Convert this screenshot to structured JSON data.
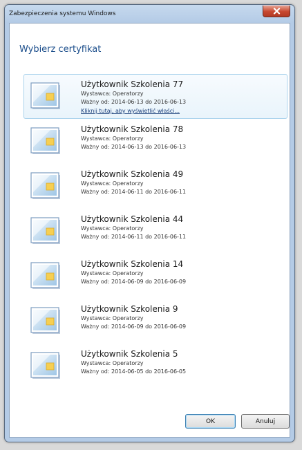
{
  "window": {
    "title": "Zabezpieczenia systemu Windows",
    "heading": "Wybierz certyfikat"
  },
  "certificates": [
    {
      "name": "Użytkownik Szkolenia 77",
      "issuer": "Wystawca: Operatorzy",
      "valid": "Ważny od: 2014-06-13 do 2016-06-13",
      "link": "Kliknij tutaj, aby wyświetlić właści...",
      "selected": true
    },
    {
      "name": "Użytkownik Szkolenia 78",
      "issuer": "Wystawca: Operatorzy",
      "valid": "Ważny od: 2014-06-13 do 2016-06-13"
    },
    {
      "name": "Użytkownik Szkolenia 49",
      "issuer": "Wystawca: Operatorzy",
      "valid": "Ważny od: 2014-06-11 do 2016-06-11"
    },
    {
      "name": "Użytkownik Szkolenia 44",
      "issuer": "Wystawca: Operatorzy",
      "valid": "Ważny od: 2014-06-11 do 2016-06-11"
    },
    {
      "name": "Użytkownik Szkolenia 14",
      "issuer": "Wystawca: Operatorzy",
      "valid": "Ważny od: 2014-06-09 do 2016-06-09"
    },
    {
      "name": "Użytkownik Szkolenia 9",
      "issuer": "Wystawca: Operatorzy",
      "valid": "Ważny od: 2014-06-09 do 2016-06-09"
    },
    {
      "name": "Użytkownik Szkolenia 5",
      "issuer": "Wystawca: Operatorzy",
      "valid": "Ważny od: 2014-06-05 do 2016-06-05"
    }
  ],
  "buttons": {
    "ok": "OK",
    "cancel": "Anuluj"
  },
  "icons": {
    "close": "close-icon",
    "certificate": "certificate-icon"
  },
  "colors": {
    "heading": "#1d4f8c",
    "selection_border": "#a8d2ec",
    "close_button": "#c7472f"
  }
}
